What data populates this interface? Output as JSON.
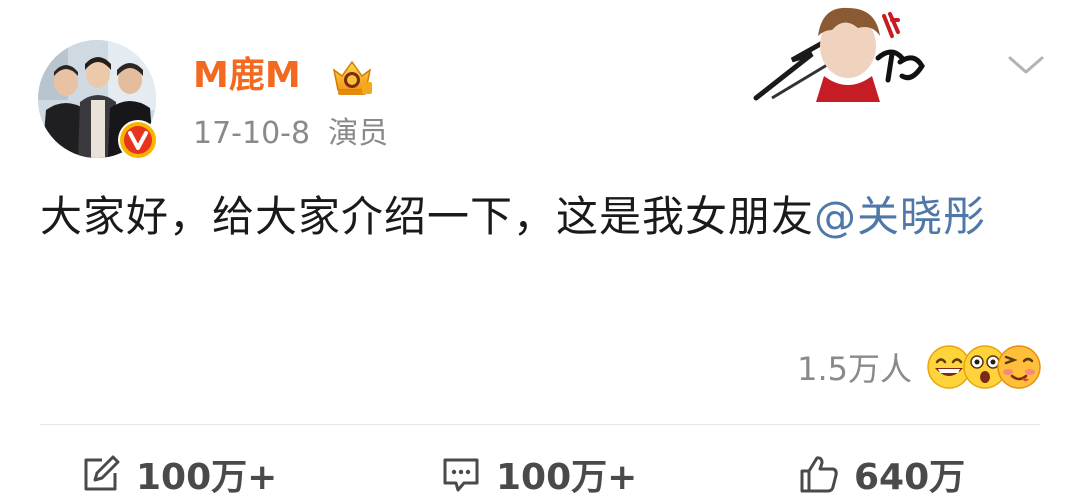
{
  "post": {
    "author": {
      "name": "M鹿M",
      "avatar_icon": "group-photo-avatar",
      "verified_icon": "verified-v-badge",
      "vip_icon": "vip-crown-icon",
      "name_color": "#f2691f"
    },
    "meta": {
      "date": "17-10-8",
      "source": "演员"
    },
    "content": {
      "text": "大家好，给大家介绍一下，这是我女朋友",
      "mention": "@关晓彤"
    },
    "reactions": {
      "count": "1.5万人",
      "emojis": [
        "laughing-emoji",
        "surprised-emoji",
        "wink-emoji"
      ]
    },
    "actions": {
      "repost_count": "100万+",
      "comment_count": "100万+",
      "like_count": "640万"
    },
    "colors": {
      "mention": "#4f78a8",
      "meta": "#8a8a8a"
    }
  }
}
